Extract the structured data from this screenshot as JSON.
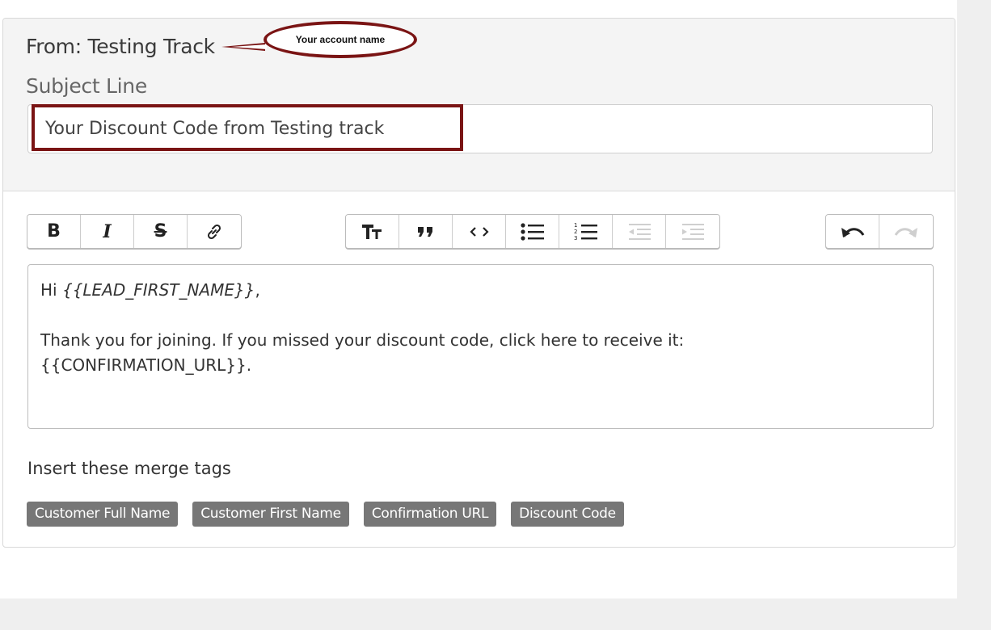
{
  "sender": {
    "from_text": "From: Testing Track"
  },
  "annotation": {
    "label": "Your account name",
    "color": "#7a1414"
  },
  "subject": {
    "label": "Subject Line",
    "value": "Your Discount Code from Testing track"
  },
  "toolbar": {
    "format_group": [
      {
        "name": "bold-icon",
        "glyph": "B"
      },
      {
        "name": "italic-icon",
        "glyph": "I"
      },
      {
        "name": "strikethrough-icon",
        "glyph": "S"
      },
      {
        "name": "link-icon",
        "glyph": "link"
      }
    ],
    "block_group": [
      {
        "name": "heading-icon",
        "glyph": "TT"
      },
      {
        "name": "quote-icon",
        "glyph": "quote"
      },
      {
        "name": "code-icon",
        "glyph": "<>"
      },
      {
        "name": "bullet-list-icon",
        "glyph": "ul"
      },
      {
        "name": "numbered-list-icon",
        "glyph": "ol"
      },
      {
        "name": "decrease-indent-icon",
        "glyph": "outdent",
        "disabled": true
      },
      {
        "name": "increase-indent-icon",
        "glyph": "indent",
        "disabled": true
      }
    ],
    "history_group": [
      {
        "name": "undo-icon",
        "glyph": "undo"
      },
      {
        "name": "redo-icon",
        "glyph": "redo",
        "disabled": true
      }
    ]
  },
  "body": {
    "greeting_prefix": "Hi ",
    "greeting_tag": "{{LEAD_FIRST_NAME}}",
    "greeting_suffix": ",",
    "line1": "Thank you for joining. If you missed your discount code, click here to receive it:",
    "line2": "{{CONFIRMATION_URL}}."
  },
  "merge": {
    "label": "Insert these merge tags",
    "tags": [
      "Customer Full Name",
      "Customer First Name",
      "Confirmation URL",
      "Discount Code"
    ],
    "chip_color": "#777777"
  }
}
